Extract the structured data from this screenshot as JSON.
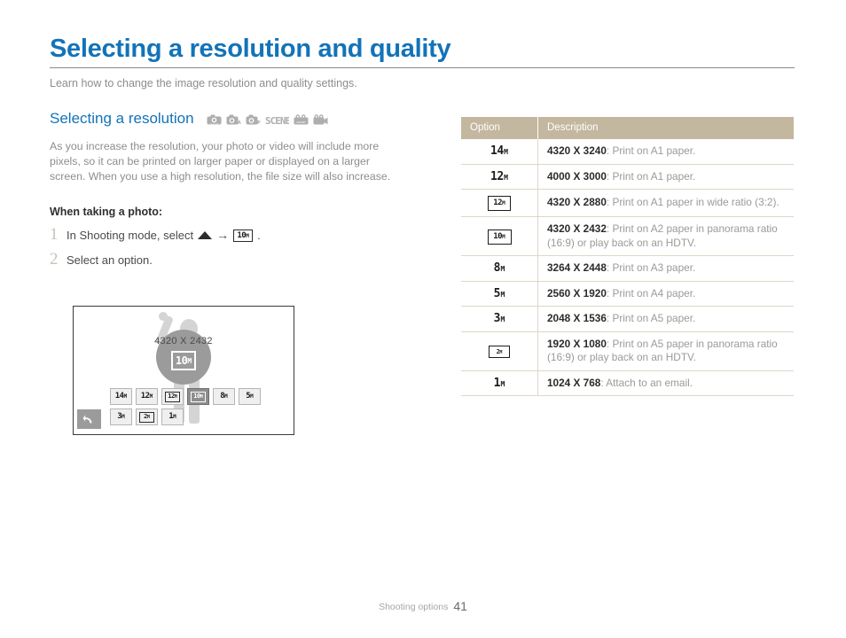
{
  "page": {
    "title": "Selecting a resolution and quality",
    "subtitle": "Learn how to change the image resolution and quality settings.",
    "accent_color": "#1273b8",
    "table_header_color": "#c3b79f"
  },
  "section": {
    "title": "Selecting a resolution",
    "mode_icons": [
      "smart-camera-icon",
      "camera-auto-icon",
      "camera-program-icon",
      "scene-mode-icon",
      "smart-movie-icon",
      "movie-camera-icon"
    ],
    "paragraph": "As you increase the resolution, your photo or video will include more pixels, so it can be printed on larger paper or displayed on a larger screen. When you use a high resolution, the file size will also increase.",
    "subhead": "When taking a photo:",
    "steps": [
      {
        "num": "1",
        "text_before": "In Shooting mode, select",
        "arrow": "→",
        "text_after": "."
      },
      {
        "num": "2",
        "text_before": "Select an option.",
        "arrow": "",
        "text_after": ""
      }
    ]
  },
  "camera_screen": {
    "resolution_label": "4320 X 2432",
    "selected_icon": {
      "digit": "10",
      "unit": "M"
    },
    "back_button": "back-icon",
    "buttons_row1": [
      {
        "digit": "14",
        "unit": "M",
        "style": "plain",
        "selected": false
      },
      {
        "digit": "12",
        "unit": "M",
        "style": "plain",
        "selected": false
      },
      {
        "digit": "12",
        "unit": "M",
        "style": "boxed",
        "selected": false
      },
      {
        "digit": "10",
        "unit": "M",
        "style": "boxed",
        "selected": true
      },
      {
        "digit": "8",
        "unit": "M",
        "style": "plain",
        "selected": false
      },
      {
        "digit": "5",
        "unit": "M",
        "style": "plain",
        "selected": false
      }
    ],
    "buttons_row2": [
      {
        "digit": "3",
        "unit": "M",
        "style": "plain",
        "selected": false
      },
      {
        "digit": "2",
        "unit": "M",
        "style": "boxed",
        "selected": false
      },
      {
        "digit": "1",
        "unit": "M",
        "style": "plain",
        "selected": false
      }
    ]
  },
  "table": {
    "headers": {
      "option": "Option",
      "description": "Description"
    },
    "rows": [
      {
        "icon": {
          "digit": "14",
          "unit": "M",
          "style": "plain"
        },
        "resolution": "4320 X 3240",
        "description": ": Print on A1 paper."
      },
      {
        "icon": {
          "digit": "12",
          "unit": "M",
          "style": "plain"
        },
        "resolution": "4000 X 3000",
        "description": ": Print on A1 paper."
      },
      {
        "icon": {
          "digit": "12",
          "unit": "M",
          "style": "wide"
        },
        "resolution": "4320 X 2880",
        "description": ": Print on A1 paper in wide ratio (3:2)."
      },
      {
        "icon": {
          "digit": "10",
          "unit": "M",
          "style": "pano"
        },
        "resolution": "4320 X 2432",
        "description": ": Print on A2 paper in panorama ratio (16:9) or play back on an HDTV."
      },
      {
        "icon": {
          "digit": "8",
          "unit": "M",
          "style": "plain"
        },
        "resolution": "3264 X 2448",
        "description": ": Print on A3 paper."
      },
      {
        "icon": {
          "digit": "5",
          "unit": "M",
          "style": "plain"
        },
        "resolution": "2560 X 1920",
        "description": ": Print on A4 paper."
      },
      {
        "icon": {
          "digit": "3",
          "unit": "M",
          "style": "plain"
        },
        "resolution": "2048 X 1536",
        "description": ": Print on A5 paper."
      },
      {
        "icon": {
          "digit": "2",
          "unit": "M",
          "style": "small"
        },
        "resolution": "1920 X 1080",
        "description": ": Print on A5 paper in panorama ratio (16:9) or play back on an HDTV."
      },
      {
        "icon": {
          "digit": "1",
          "unit": "M",
          "style": "plain"
        },
        "resolution": "1024 X 768",
        "description": ": Attach to an email."
      }
    ]
  },
  "footer": {
    "section_name": "Shooting options",
    "page_number": "41"
  }
}
